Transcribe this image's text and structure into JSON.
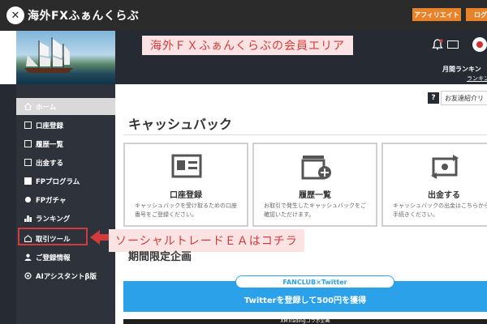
{
  "header": {
    "logo_text": "海外FXふぁんくらぶ",
    "affiliate_label": "アフィリエイト",
    "login_label": "ログ"
  },
  "banner": {
    "member_area": "海外ＦＸふぁんくらぶの会員エリア",
    "ranking_title": "月間ランキン",
    "ranking_sub": "ランキン"
  },
  "sidebar": {
    "items": [
      {
        "label": "ホーム",
        "icon": "home-icon",
        "active": true
      },
      {
        "label": "口座登録",
        "icon": "account-icon"
      },
      {
        "label": "履歴一覧",
        "icon": "history-icon"
      },
      {
        "label": "出金する",
        "icon": "withdraw-icon"
      },
      {
        "label": "FPプログラム",
        "icon": "gift-icon"
      },
      {
        "label": "FPガチャ",
        "icon": "gacha-icon"
      },
      {
        "label": "ランキング",
        "icon": "ranking-icon"
      },
      {
        "label": "取引ツール",
        "icon": "tools-icon"
      },
      {
        "label": "ご登録情報",
        "icon": "user-icon"
      },
      {
        "label": "AIアシスタントβ版",
        "icon": "ai-icon"
      }
    ]
  },
  "callout": {
    "text": "ソーシャルトレードＥＡはコチラ"
  },
  "main": {
    "help_label": "?",
    "friend_label": "お友達紹介リ",
    "section_title": "キャッシュバック",
    "cards": [
      {
        "title": "口座登録",
        "desc": "キャッシュバックを受け取るための口座番号をご登録ください。"
      },
      {
        "title": "履歴一覧",
        "desc": "お取引で発生したキャッシュバックをご確認いただけます。"
      },
      {
        "title": "出金する",
        "desc": "キャッシュバックの出金はこちらからお手続きください。"
      }
    ],
    "limited_title": "期間限定企画",
    "fanclub_pill": "FANCLUB×Twitter",
    "twitter_text": "Twitterを登録して500円を獲得",
    "xm_text": "XMTradingコラボ企画"
  }
}
